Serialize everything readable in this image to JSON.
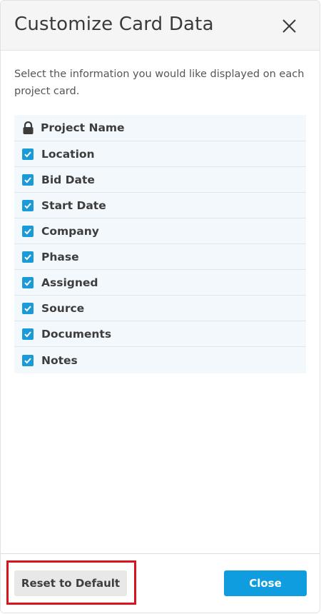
{
  "dialog": {
    "title": "Customize Card Data",
    "close_icon": "close-icon",
    "description": "Select the information you would like displayed on each project card."
  },
  "fields": {
    "locked": {
      "label": "Project Name",
      "icon": "lock-icon"
    },
    "items": [
      {
        "label": "Location",
        "checked": true
      },
      {
        "label": "Bid Date",
        "checked": true
      },
      {
        "label": "Start Date",
        "checked": true
      },
      {
        "label": "Company",
        "checked": true
      },
      {
        "label": "Phase",
        "checked": true
      },
      {
        "label": "Assigned",
        "checked": true
      },
      {
        "label": "Source",
        "checked": true
      },
      {
        "label": "Documents",
        "checked": true
      },
      {
        "label": "Notes",
        "checked": true
      }
    ]
  },
  "footer": {
    "reset_label": "Reset to Default",
    "close_label": "Close"
  },
  "colors": {
    "accent": "#0f9de0",
    "checkbox": "#1a9bd7",
    "list_background": "#f2f8fb",
    "highlight": "#d9141b"
  }
}
